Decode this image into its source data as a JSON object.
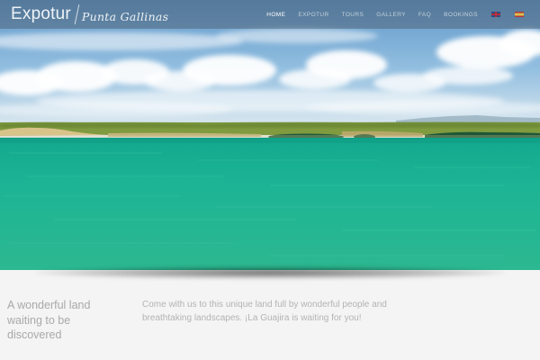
{
  "brand": {
    "name": "Expotur",
    "sub_name": "Punta Gallinas"
  },
  "nav": {
    "items": [
      {
        "label": "Home",
        "active": true
      },
      {
        "label": "Expotur",
        "active": false
      },
      {
        "label": "Tours",
        "active": false
      },
      {
        "label": "Gallery",
        "active": false
      },
      {
        "label": "FAQ",
        "active": false
      },
      {
        "label": "Bookings",
        "active": false
      }
    ],
    "languages": [
      {
        "icon": "uk-flag-icon"
      },
      {
        "icon": "spain-flag-icon"
      }
    ]
  },
  "hero": {
    "scene": "turquoise sea with coastline and cloudy sky"
  },
  "content": {
    "tagline": "A wonderful land waiting to be discovered",
    "intro": "Come with us to this unique land full by wonderful people and breathtaking landscapes. ¡La Guajira is waiting for you!"
  },
  "colors": {
    "sea": "#1fb28f",
    "sky": "#7fb0d8",
    "nav_bg": "#46505f",
    "tagline_text": "#a9a9a9",
    "page_bg": "#f4f4f4"
  }
}
